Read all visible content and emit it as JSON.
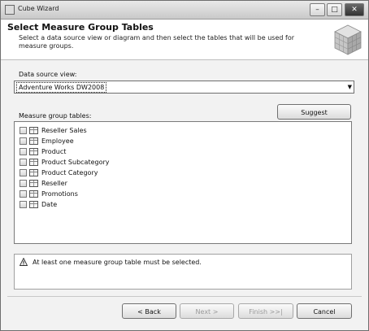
{
  "window": {
    "title": "Cube Wizard",
    "controls": {
      "minimize": "–",
      "maximize": "□",
      "close": "✕"
    }
  },
  "header": {
    "title": "Select Measure Group Tables",
    "description": "Select a data source view or diagram and then select the tables that will be used for measure groups."
  },
  "data_source_view": {
    "label": "Data source view:",
    "value": "Adventure Works DW2008"
  },
  "measure_group_tables": {
    "label": "Measure group tables:",
    "suggest_label": "Suggest",
    "items": [
      {
        "label": "Reseller Sales",
        "checked": false
      },
      {
        "label": "Employee",
        "checked": false
      },
      {
        "label": "Product",
        "checked": false
      },
      {
        "label": "Product Subcategory",
        "checked": false
      },
      {
        "label": "Product Category",
        "checked": false
      },
      {
        "label": "Reseller",
        "checked": false
      },
      {
        "label": "Promotions",
        "checked": false
      },
      {
        "label": "Date",
        "checked": false
      }
    ]
  },
  "message": {
    "icon": "warning-icon",
    "text": "At least one measure group table must be selected."
  },
  "footer": {
    "back": "< Back",
    "next": "Next >",
    "finish": "Finish >>|",
    "cancel": "Cancel"
  }
}
